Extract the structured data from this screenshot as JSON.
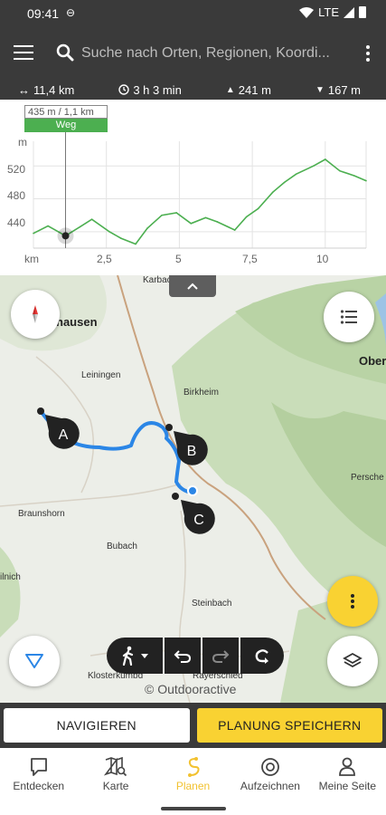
{
  "status_bar": {
    "time": "09:41",
    "network": "LTE"
  },
  "search": {
    "placeholder": "Suche nach Orten, Regionen, Koordi..."
  },
  "stats": {
    "distance": "11,4 km",
    "duration": "3 h 3 min",
    "ascent": "241 m",
    "descent": "167 m"
  },
  "profile": {
    "tooltip_value": "435 m / 1,1 km",
    "tooltip_surface": "Weg",
    "y_unit": "m",
    "x_unit": "km",
    "y_ticks": [
      "520",
      "480",
      "440"
    ],
    "x_ticks": [
      "2,5",
      "5",
      "7,5",
      "10"
    ]
  },
  "chart_data": {
    "type": "line",
    "xlabel": "km",
    "ylabel": "m",
    "xlim": [
      0,
      11.4
    ],
    "ylim": [
      420,
      550
    ],
    "x": [
      0,
      0.5,
      1.1,
      1.6,
      2.0,
      2.6,
      3.0,
      3.5,
      3.9,
      4.4,
      4.9,
      5.4,
      5.9,
      6.3,
      6.9,
      7.3,
      7.7,
      8.2,
      8.6,
      9.0,
      9.6,
      10.0,
      10.5,
      11.0,
      11.4
    ],
    "y": [
      438,
      447,
      435,
      446,
      455,
      440,
      432,
      425,
      444,
      460,
      463,
      450,
      457,
      452,
      442,
      458,
      468,
      488,
      500,
      510,
      520,
      528,
      514,
      508,
      502
    ],
    "series": [
      {
        "name": "Weg",
        "color": "#4caf50"
      }
    ],
    "marker": {
      "x": 1.1,
      "y": 435
    }
  },
  "map": {
    "places": {
      "hausen": "hausen",
      "leiningen": "Leiningen",
      "birkheim": "Birkheim",
      "braunshorn": "Braunshorn",
      "bubach": "Bubach",
      "steinbach": "Steinbach",
      "nich": "ilnich",
      "kloster": "Klosterkumbd",
      "rayerschied": "Rayerschied",
      "karbach": "Karbac",
      "ober": "Ober",
      "persche": "Persche"
    },
    "waypoints": [
      "A",
      "B",
      "C"
    ],
    "copyright": "© Outdooractive"
  },
  "actions": {
    "navigate": "NAVIGIEREN",
    "save": "PLANUNG SPEICHERN"
  },
  "bottom_nav": [
    {
      "label": "Entdecken",
      "icon": "chat-bubble-icon"
    },
    {
      "label": "Karte",
      "icon": "map-search-icon"
    },
    {
      "label": "Planen",
      "icon": "route-icon",
      "active": true
    },
    {
      "label": "Aufzeichnen",
      "icon": "record-icon"
    },
    {
      "label": "Meine Seite",
      "icon": "person-icon"
    }
  ],
  "colors": {
    "accent": "#f9d232",
    "route": "#2b86e6",
    "profile_line": "#4caf50",
    "dark": "#3a3a3a"
  }
}
